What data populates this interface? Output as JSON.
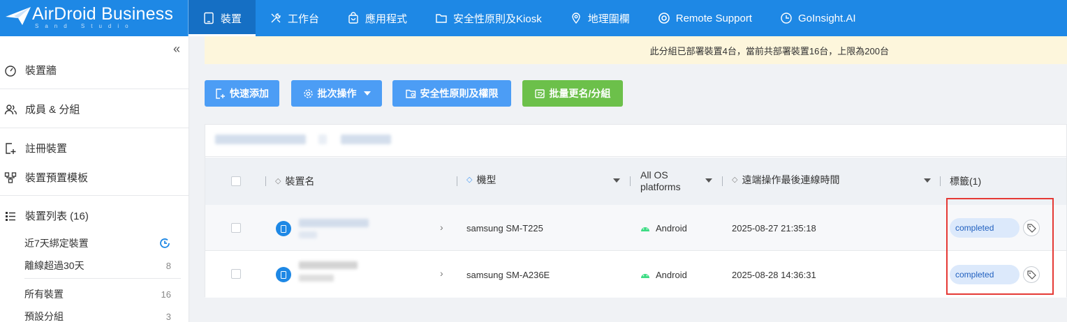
{
  "brand": {
    "name": "AirDroid Business",
    "sub": "Sand Studio"
  },
  "nav": [
    {
      "label": "裝置",
      "icon": "tablet-icon"
    },
    {
      "label": "工作台",
      "icon": "tools-icon"
    },
    {
      "label": "應用程式",
      "icon": "shopping-bag-icon"
    },
    {
      "label": "安全性原則及Kiosk",
      "icon": "folder-icon"
    },
    {
      "label": "地理圍欄",
      "icon": "map-pin-icon"
    },
    {
      "label": "Remote Support",
      "icon": "lifebuoy-icon"
    },
    {
      "label": "GoInsight.AI",
      "icon": "ai-icon"
    }
  ],
  "sidebar": {
    "collapse": "«",
    "sections": [
      {
        "label": "裝置牆",
        "icon": "dashboard-icon"
      },
      {
        "label": "成員 & 分組",
        "icon": "users-icon"
      },
      {
        "label": "註冊裝置",
        "icon": "register-device-icon"
      },
      {
        "label": "裝置預置模板",
        "icon": "template-icon"
      },
      {
        "label": "裝置列表 (16)",
        "icon": "list-icon"
      }
    ],
    "subitems": [
      {
        "label": "近7天綁定裝置",
        "count": ""
      },
      {
        "label": "離線超過30天",
        "count": "8"
      },
      {
        "label": "所有裝置",
        "count": "16"
      },
      {
        "label": "預設分組",
        "count": "3"
      }
    ]
  },
  "notice": "此分組已部署裝置4台，當前共部署裝置16台，上限為200台",
  "toolbar": {
    "quick_add": "快速添加",
    "batch": "批次操作",
    "policy": "安全性原則及權限",
    "rename": "批量更名/分組"
  },
  "table": {
    "headers": {
      "name": "裝置名",
      "model": "機型",
      "os": "All OS platforms",
      "last_online": "遠端操作最後連線時間",
      "tags": "標籤(1)"
    },
    "rows": [
      {
        "model": "samsung SM-T225",
        "os": "Android",
        "last_online": "2025-08-27 21:35:18",
        "tag": "completed"
      },
      {
        "model": "samsung SM-A236E",
        "os": "Android",
        "last_online": "2025-08-28 14:36:31",
        "tag": "completed"
      }
    ]
  },
  "colors": {
    "primary": "#1e88e5",
    "button_blue": "#4c9df5",
    "button_green": "#6cc04a",
    "highlight": "#e53935"
  }
}
